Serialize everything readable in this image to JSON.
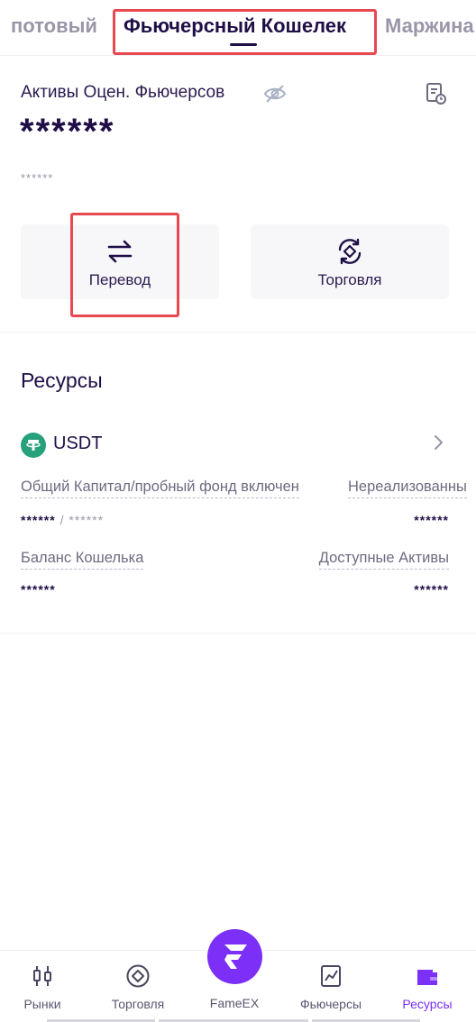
{
  "tabs": [
    {
      "label": "потовый"
    },
    {
      "label": "Фьючерсный Кошелек"
    },
    {
      "label": "Маржина"
    }
  ],
  "assets": {
    "title": "Активы Оцен. Фьючерсов",
    "total_masked": "******",
    "sub_masked": "******"
  },
  "actions": [
    {
      "label": "Перевод",
      "icon": "transfer-arrows-icon"
    },
    {
      "label": "Торговля",
      "icon": "trade-exchange-icon"
    }
  ],
  "resources": {
    "title": "Ресурсы",
    "coin": "USDT",
    "coin_icon": "tether-icon",
    "total_capital_label": "Общий Капитал/пробный фонд включен",
    "unrealized_label": "Нереализованны",
    "total_capital_value": "******",
    "total_capital_sep": "/",
    "trial_fund_value": "******",
    "unrealized_value": "******",
    "wallet_balance_label": "Баланс Кошелька",
    "available_label": "Доступные Активы",
    "wallet_balance_value": "******",
    "available_value": "******"
  },
  "nav": {
    "items": [
      {
        "label": "Рынки",
        "icon": "candlestick-icon"
      },
      {
        "label": "Торговля",
        "icon": "trade-circle-icon"
      },
      {
        "label": "FameEX",
        "icon": "fameex-logo-icon"
      },
      {
        "label": "Фьючерсы",
        "icon": "chart-icon"
      },
      {
        "label": "Ресурсы",
        "icon": "wallet-icon"
      }
    ],
    "active": "Ресурсы"
  },
  "colors": {
    "accent": "#7b2ff7",
    "text_dark": "#1f0f46",
    "highlight_box": "#e8484f",
    "tether": "#26a17b"
  }
}
